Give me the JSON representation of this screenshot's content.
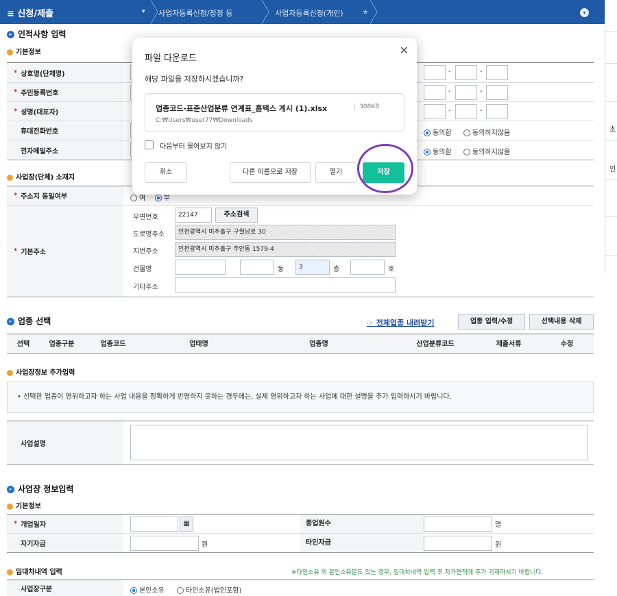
{
  "topbar": {
    "menu": "≡ 신청/제출",
    "dropdown": "▾",
    "crumbs": [
      "사업자등록신청/정정 등",
      "사업자등록신청(개인)"
    ],
    "star": "★"
  },
  "right_panel_chars": [
    "초",
    "인"
  ],
  "sections": {
    "personal": "인적사항 입력",
    "basic": "기본정보",
    "address": "사업장(단체) 소재지",
    "industry": "업종 선택",
    "extra": "사업장정보 추가입력",
    "bizinfo": "사업장 정보입력",
    "basic2": "기본정보",
    "lease": "임대차내역 입력"
  },
  "personal_rows": {
    "trade_name": "상호명(단체명)",
    "resident_no": "주민등록번호",
    "rep_name": "성명(대표자)",
    "mobile": "휴대전화번호",
    "email": "전자메일주소"
  },
  "consent": {
    "agree": "동의함",
    "disagree": "동의하지않음"
  },
  "phone_dash": "-",
  "address": {
    "same_label": "주소지 동일여부",
    "yes": "여",
    "no": "부",
    "basic_label": "기본주소",
    "zip_label": "우편번호",
    "zip": "22147",
    "zip_btn": "주소검색",
    "road_label": "도로명주소",
    "road": "인천광역시 미추홀구 구월남로 30",
    "jibun_label": "지번주소",
    "jibun": "인천광역시 미추홀구 주안동 1579-4",
    "building_label": "건물명",
    "dong": "동",
    "floor": "3",
    "floor_unit": "층",
    "ho": "호",
    "etc_label": "기타주소"
  },
  "industry": {
    "download_link": "전체업종 내려받기",
    "input_btn": "업종 입력/수정",
    "delete_btn": "선택내용 삭제",
    "columns": [
      "선택",
      "업종구분",
      "업종코드",
      "업태명",
      "업종명",
      "산업분류코드",
      "제출서류",
      "수정"
    ]
  },
  "extra": {
    "notice": "• 선택한 업종이 영위하고자 하는 사업 내용을 정확하게 반영하지 못하는 경우에는, 실제 영위하고자 하는 사업에 대한 설명을 추가 입력하시기 바랍니다.",
    "desc_label": "사업설명"
  },
  "bizinfo": {
    "open_date": "개업일자",
    "employees": "종업원수",
    "employees_unit": "명",
    "own_capital": "자기자금",
    "other_capital": "타인자금",
    "won": "원"
  },
  "lease": {
    "note": "※타인소유 외 본인소유분도 있는 경우, 임대차내역 입력 후 자가면적에 추가 기재하시기 바랍니다.",
    "type_label": "사업장구분",
    "own": "본인소유",
    "other": "타인소유(법인포함)"
  },
  "dialog": {
    "title": "파일 다운로드",
    "close": "✕",
    "question": "해당 파일을 저장하시겠습니까?",
    "file_name": "업종코드-표준산업분류 연계표_홈택스 게시 (1).xlsx",
    "file_size": "308KB",
    "file_path": "C:₩Users₩user77₩Downloads",
    "dont_ask": "다음부터 물어보지 않기",
    "cancel": "취소",
    "save_as": "다른 이름으로 저장",
    "open": "열기",
    "save": "저장"
  },
  "colors": {
    "topbar": "#1f5aa6",
    "save": "#12c09a",
    "highlight_ring": "#7d3bb7"
  }
}
